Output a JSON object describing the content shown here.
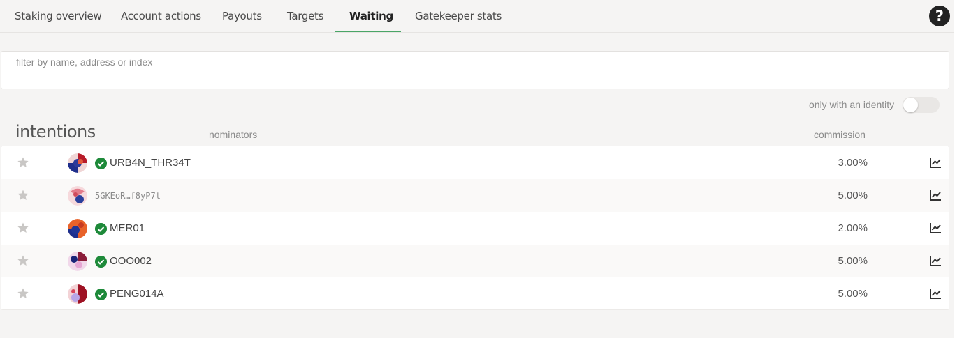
{
  "tabs": [
    {
      "label": "Staking overview",
      "active": false
    },
    {
      "label": "Account actions",
      "active": false
    },
    {
      "label": "Payouts",
      "active": false
    },
    {
      "label": "Targets",
      "active": false
    },
    {
      "label": "Waiting",
      "active": true
    },
    {
      "label": "Gatekeeper stats",
      "active": false
    }
  ],
  "help": {
    "label": "?"
  },
  "filter": {
    "placeholder": "filter by name, address or index",
    "value": ""
  },
  "identity_toggle": {
    "label": "only with an identity",
    "enabled": false
  },
  "table": {
    "title": "intentions",
    "col_nominators": "nominators",
    "col_commission": "commission",
    "rows": [
      {
        "name": "URB4N_THR34T",
        "verified": true,
        "commission": "3.00%"
      },
      {
        "name": "5GKEoR…f8yP7t",
        "verified": false,
        "commission": "5.00%"
      },
      {
        "name": "MER01",
        "verified": true,
        "commission": "2.00%"
      },
      {
        "name": "OOO002",
        "verified": true,
        "commission": "5.00%"
      },
      {
        "name": "PENG014A",
        "verified": true,
        "commission": "5.00%"
      }
    ]
  },
  "colors": {
    "accent": "#4aa566",
    "verified": "#1e8a3a",
    "background": "#f5f4f3"
  }
}
